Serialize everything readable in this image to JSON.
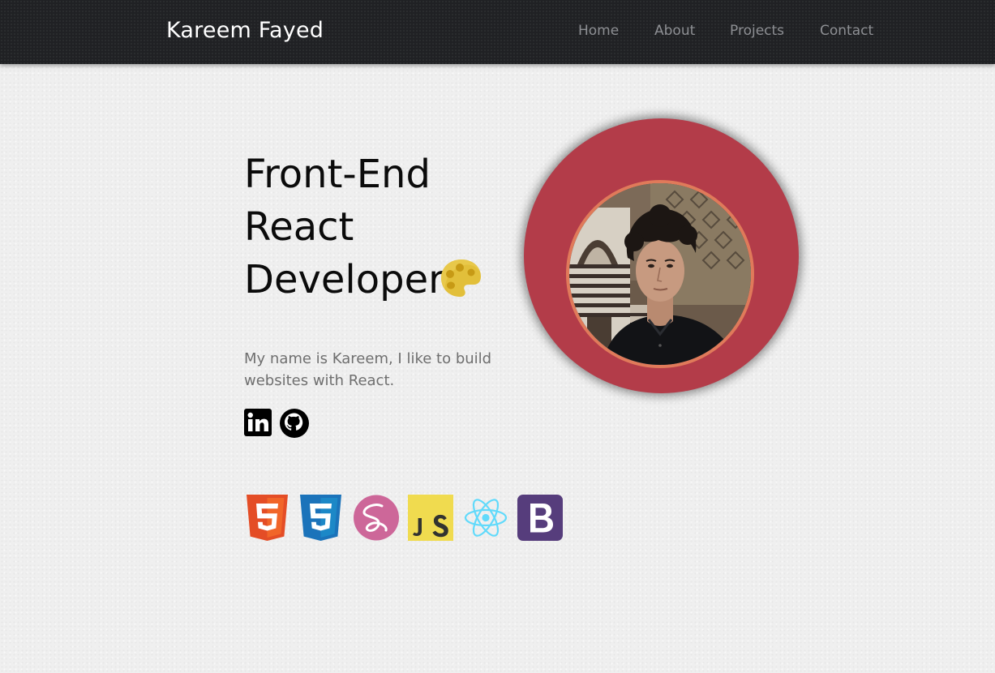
{
  "header": {
    "brand": "Kareem Fayed",
    "nav": [
      {
        "label": "Home"
      },
      {
        "label": "About"
      },
      {
        "label": "Projects"
      },
      {
        "label": "Contact"
      }
    ]
  },
  "hero": {
    "title_lines": [
      "Front-End",
      "React",
      "Developer"
    ],
    "title_icon": "artist-palette-icon",
    "intro": "My name is Kareem, I like to build websites with React.",
    "social": [
      {
        "icon": "linkedin-icon"
      },
      {
        "icon": "github-icon"
      }
    ],
    "avatar": {
      "ring_color": "#b33c49",
      "border_color": "#e07a5a"
    }
  },
  "tech_stack": [
    {
      "icon": "html5-icon",
      "color": "#e44d26"
    },
    {
      "icon": "css3-icon",
      "color": "#1b73ba"
    },
    {
      "icon": "sass-icon",
      "color": "#cd6799"
    },
    {
      "icon": "javascript-icon",
      "color": "#f0db4f"
    },
    {
      "icon": "react-icon",
      "color": "#61dafb"
    },
    {
      "icon": "bootstrap-icon",
      "color": "#563d7c"
    }
  ],
  "colors": {
    "navbar_bg": "#202124",
    "page_bg": "#efefef",
    "nav_link": "#8d8f93"
  }
}
